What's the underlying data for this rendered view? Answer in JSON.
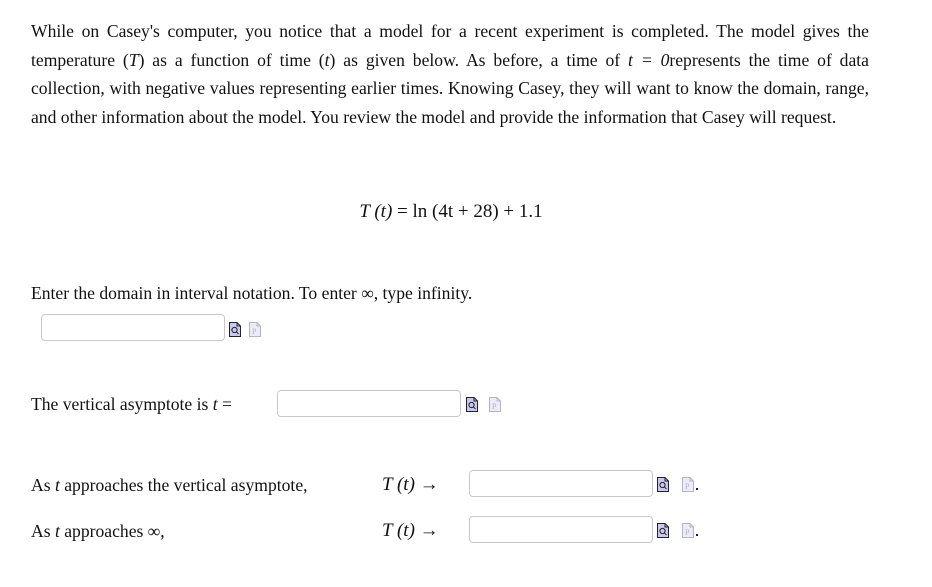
{
  "intro": {
    "text_before_T": "While on Casey's computer, you notice that a model for a recent experiment is completed. The model gives the temperature (",
    "var_T": "T",
    "text_between": ") as a function of time (",
    "var_t": "t",
    "text_after_t": ") as given below. As before, a time of ",
    "math_t0": "t = 0",
    "text_end": "represents the time of data collection, with negative values representing earlier times. Knowing Casey, they will want to know the domain, range, and other information about the model. You review the model and provide the information that Casey will request."
  },
  "equation": {
    "lhs": "T (t)",
    "rhs": "= ln (4t + 28) + 1.1"
  },
  "questions": {
    "domain": {
      "prompt": "Enter the domain in interval notation. To enter ∞, type infinity.",
      "value": "",
      "placeholder": ""
    },
    "asymptote": {
      "prompt_text": "The vertical asymptote is ",
      "prompt_var": "t",
      "prompt_eq": " =",
      "value": "",
      "placeholder": ""
    },
    "limit_asymptote": {
      "prompt_as": "As ",
      "prompt_var": "t",
      "prompt_rest": " approaches the vertical asymptote,",
      "expr": "T (t) →",
      "value": "",
      "placeholder": ""
    },
    "limit_infinity": {
      "prompt_as": "As ",
      "prompt_var": "t",
      "prompt_rest": " approaches ∞,",
      "expr": "T (t) →",
      "value": "",
      "placeholder": ""
    }
  },
  "icons": {
    "preview": "preview-magnifier-icon",
    "palette": "math-palette-p-icon"
  },
  "colors": {
    "preview_icon_fill": "#c8c8f0",
    "palette_icon_fill": "#ececf8",
    "input_border": "#c9c9c9"
  }
}
